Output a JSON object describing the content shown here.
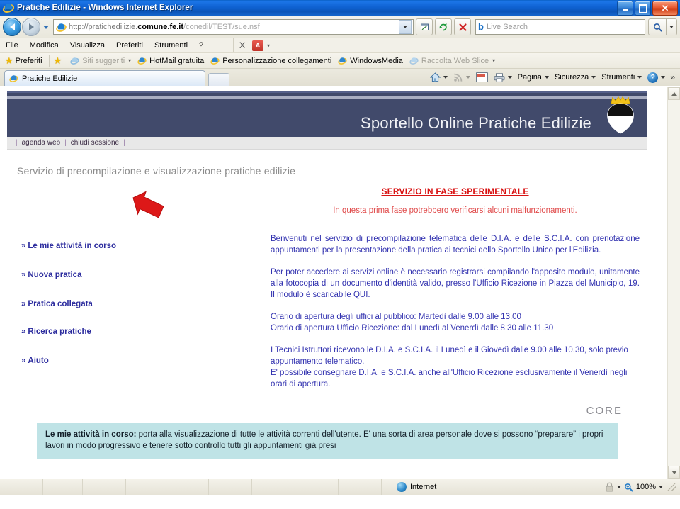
{
  "window": {
    "title": "Pratiche Edilizie - Windows Internet Explorer",
    "minimize_label": "Riduci a icona",
    "maximize_label": "Ingrandisci",
    "close_label": "Chiudi"
  },
  "address_bar": {
    "url_prefix": "http://pratichedilizie.",
    "url_domain": "comune.fe.it",
    "url_suffix": "/conedil/TEST/sue.nsf",
    "back_label": "Indietro",
    "forward_label": "Avanti",
    "history_label": "Pagine recenti",
    "compat_label": "Visualizzazione compatibilita",
    "refresh_label": "Aggiorna",
    "stop_label": "Interrompi"
  },
  "search": {
    "provider": "b",
    "placeholder": "Live Search",
    "go_label": "Cerca"
  },
  "menubar": {
    "items": [
      "File",
      "Modifica",
      "Visualizza",
      "Preferiti",
      "Strumenti",
      "?"
    ],
    "close_label": "X",
    "pdf_label": "PDF"
  },
  "favorites_bar": {
    "favorites_label": "Preferiti",
    "items": [
      {
        "label": "Siti suggeriti",
        "dim": true,
        "caret": true
      },
      {
        "label": "HotMail gratuita",
        "dim": false,
        "caret": false
      },
      {
        "label": "Personalizzazione collegamenti",
        "dim": false,
        "caret": false
      },
      {
        "label": "WindowsMedia",
        "dim": false,
        "caret": false
      },
      {
        "label": "Raccolta Web Slice",
        "dim": true,
        "caret": true
      }
    ]
  },
  "tabs": {
    "items": [
      {
        "label": "Pratiche Edilizie",
        "active": true
      }
    ],
    "new_tab_label": "Nuova scheda"
  },
  "command_bar": {
    "home_label": "Home",
    "feeds_label": "Feed",
    "mail_label": "Posta",
    "print_label": "Stampa",
    "page_label": "Pagina",
    "security_label": "Sicurezza",
    "tools_label": "Strumenti",
    "help_label": "?",
    "overflow_label": "»"
  },
  "site": {
    "banner_title": "Sportello Online Pratiche Edilizie",
    "crest_name": "stemma-comune-ferrara",
    "subnav": [
      {
        "label": "agenda web"
      },
      {
        "label": "chiudi sessione"
      }
    ],
    "page_subtitle": "Servizio di precompilazione e visualizzazione pratiche edilizie",
    "alert_heading": "SERVIZIO IN FASE SPERIMENTALE",
    "alert_subtext": "In questa prima fase potrebbero verificarsi alcuni malfunzionamenti.",
    "nav_items": [
      {
        "label": "Le mie attività in corso",
        "marker": "»"
      },
      {
        "label": "Nuova pratica",
        "marker": "»"
      },
      {
        "label": "Pratica collegata",
        "marker": "»"
      },
      {
        "label": "Ricerca pratiche",
        "marker": "»"
      },
      {
        "label": "Aiuto",
        "marker": "»"
      }
    ],
    "paragraphs": [
      "Benvenuti nel servizio di precompilazione telematica delle D.I.A. e delle S.C.I.A. con prenotazione appuntamenti per la presentazione della pratica ai tecnici dello Sportello Unico per l'Edilizia.",
      "Per poter accedere ai servizi online è necessario registrarsi compilando l'apposito modulo, unitamente alla fotocopia di un documento d'identità valido, presso l'Ufficio Ricezione in Piazza del Municipio, 19. Il modulo è scaricabile QUI.",
      "Orario di apertura degli uffici al pubblico: Martedì dalle 9.00 alle 13.00\nOrario di apertura Ufficio Ricezione: dal Lunedì al Venerdì dalle 8.30 alle 11.30",
      "I Tecnici Istruttori ricevono le D.I.A. e S.C.I.A. il Lunedì e il Giovedì dalle 9.00 alle 10.30, solo previo appuntamento telematico.\nE' possibile consegnare D.I.A. e S.C.I.A. anche all'Ufficio Ricezione esclusivamente il Venerdì negli orari di apertura."
    ],
    "core_logo": "CORE",
    "tip": {
      "bold_lead": "Le mie attività in corso:",
      "text": " porta alla visualizzazione di tutte le attività correnti dell'utente. E' una sorta di area personale dove si possono “preparare” i propri lavori in modo progressivo e tenere sotto controllo tutti gli appuntamenti già presi"
    },
    "annotation": {
      "name": "red-arrow-callout",
      "points_to": "Le mie attività in corso"
    }
  },
  "status_bar": {
    "zone": "Internet",
    "zoom": "100%",
    "protected_mode_label": "Modalità protetta"
  },
  "colors": {
    "banner_bg": "#414a6b",
    "link_blue": "#2c2c9e",
    "body_text_blue": "#3333b0",
    "alert_red": "#d81212",
    "alert_sub_red": "#e04a4a",
    "tip_bg": "#bfe3e6",
    "arrow_red": "#dd1818",
    "titlebar_blue": "#0f62d2"
  }
}
